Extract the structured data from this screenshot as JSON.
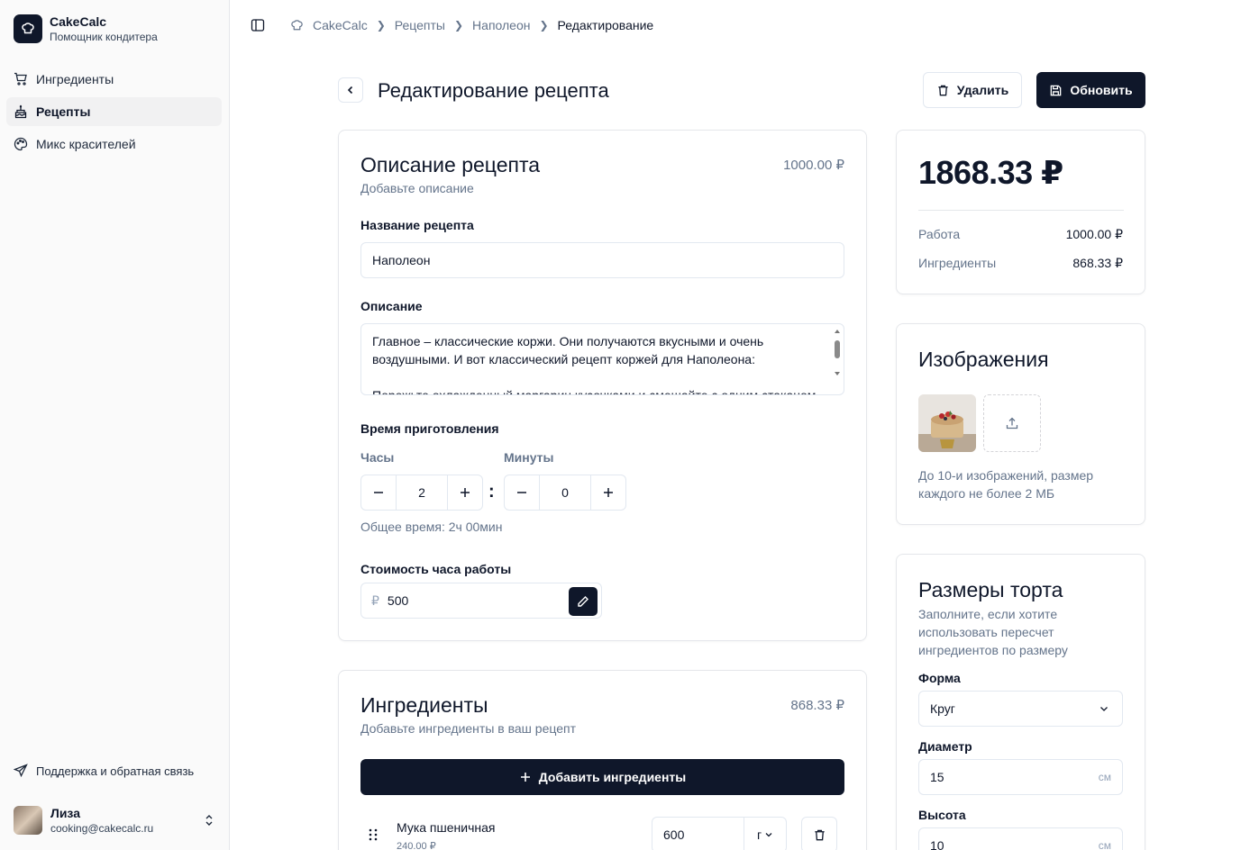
{
  "app": {
    "name": "CakeCalc",
    "subtitle": "Помощник кондитера"
  },
  "nav": [
    {
      "label": "Ингредиенты",
      "icon": "cart-icon",
      "active": false
    },
    {
      "label": "Рецепты",
      "icon": "cake-icon",
      "active": true
    },
    {
      "label": "Микс красителей",
      "icon": "palette-icon",
      "active": false
    }
  ],
  "support": {
    "label": "Поддержка и обратная связь"
  },
  "user": {
    "name": "Лиза",
    "email": "cooking@cakecalc.ru"
  },
  "breadcrumb": [
    "CakeCalc",
    "Рецепты",
    "Наполеон",
    "Редактирование"
  ],
  "header": {
    "title": "Редактирование рецепта",
    "delete_label": "Удалить",
    "update_label": "Обновить"
  },
  "description_card": {
    "title": "Описание рецепта",
    "subtitle": "Добавьте описание",
    "amount": "1000.00 ₽",
    "name_label": "Название рецепта",
    "name_value": "Наполеон",
    "desc_label": "Описание",
    "desc_value": "Главное – классические коржи. Они получаются вкусными и очень воздушными. И вот классический рецепт коржей для Наполеона:\n\nПорежьте охлажденный маргарин кусочками и смешайте с одним стаканом",
    "time_label": "Время приготовления",
    "hours_label": "Часы",
    "hours_value": "2",
    "minutes_label": "Минуты",
    "minutes_value": "0",
    "total_time": "Общее время: 2ч 00мин",
    "rate_label": "Стоимость часа работы",
    "rate_currency": "₽",
    "rate_value": "500"
  },
  "ingredients_card": {
    "title": "Ингредиенты",
    "subtitle": "Добавьте ингредиенты в ваш рецепт",
    "amount": "868.33 ₽",
    "add_label": "Добавить ингредиенты",
    "items": [
      {
        "name": "Мука пшеничная",
        "price": "240.00 ₽",
        "qty": "600",
        "unit": "г"
      }
    ]
  },
  "totals": {
    "total": "1868.33 ₽",
    "rows": [
      {
        "label": "Работа",
        "value": "1000.00 ₽"
      },
      {
        "label": "Ингредиенты",
        "value": "868.33 ₽"
      }
    ]
  },
  "images_card": {
    "title": "Изображения",
    "note": "До 10-и изображений, размер каждого не более 2 МБ"
  },
  "size_card": {
    "title": "Размеры торта",
    "subtitle": "Заполните, если хотите использовать пересчет ингредиентов по размеру",
    "shape_label": "Форма",
    "shape_value": "Круг",
    "diameter_label": "Диаметр",
    "diameter_value": "15",
    "diameter_unit": "см",
    "height_label": "Высота",
    "height_value": "10",
    "height_unit": "см"
  }
}
